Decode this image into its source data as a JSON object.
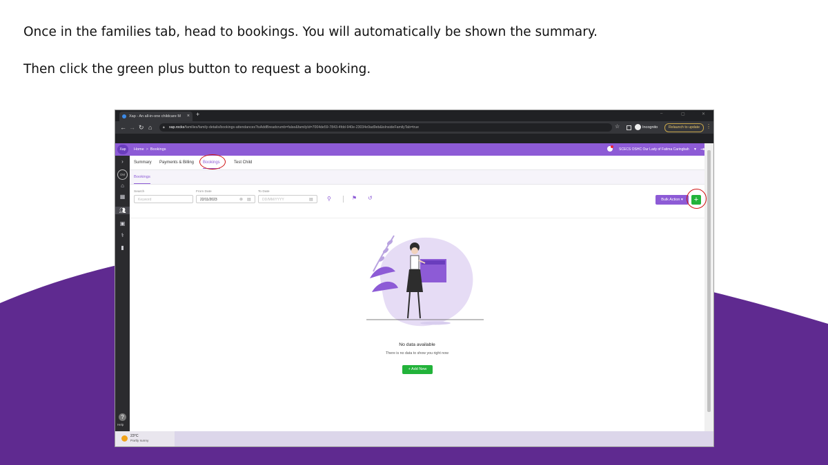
{
  "instructions": {
    "line1": "Once in the families tab, head to bookings. You will automatically be shown the summary.",
    "line2": "Then click the green plus button to request a booking."
  },
  "browser": {
    "tab_title": "Xap - An all-in-one childcare M",
    "tab_close": "×",
    "new_tab": "+",
    "url_host": "xap.rocks",
    "url_path": "/families/family-details/bookings-attendances?isAddBreadcrumb=false&familyId=7004de59-7843-4fdd-940e-23034e9ad9eb&isInsideFamilyTab=true",
    "incognito_label": "Incognito",
    "relaunch_label": "Relaunch to update",
    "win_min": "–",
    "win_max": "▢",
    "win_close": "✕"
  },
  "app": {
    "logo_text": "Xap",
    "breadcrumb_home": "Home",
    "breadcrumb_sep": ">",
    "breadcrumb_current": "Bookings",
    "org_name": "SCECS OSHC Our Lady of Fatima Caringbah",
    "nav_avatar": "OM",
    "help_label": "Help"
  },
  "tabs": [
    {
      "label": "Summary"
    },
    {
      "label": "Payments & Billing"
    },
    {
      "label": "Bookings"
    },
    {
      "label": "Test Child"
    }
  ],
  "subtab": "Bookings",
  "filters": {
    "search_label": "Search",
    "search_placeholder": "Keyword",
    "from_label": "From Date",
    "from_value": "22/11/2023",
    "to_label": "To Date",
    "to_placeholder": "DD/MM/YYYY"
  },
  "actions": {
    "bulk_action": "Bulk Action",
    "add_symbol": "+"
  },
  "empty_state": {
    "title": "No data available",
    "subtitle": "There is no data to show you right now",
    "add_new": "+ Add New"
  },
  "taskbar": {
    "temperature": "23°C",
    "weather": "Partly sunny"
  },
  "colors": {
    "accent_purple": "#8d5bd6",
    "slide_purple": "#5f2a90",
    "add_green": "#22b33a",
    "callout_red": "#d01010"
  }
}
